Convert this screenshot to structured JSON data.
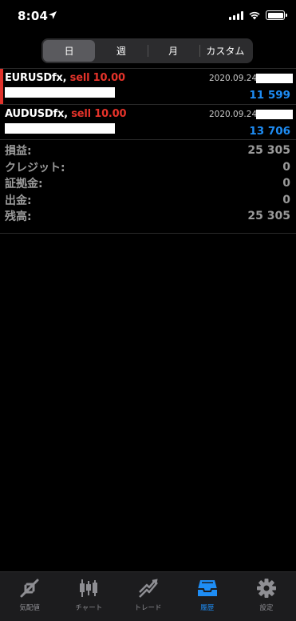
{
  "status_bar": {
    "time": "8:04"
  },
  "periods": [
    {
      "label": "日",
      "active": true
    },
    {
      "label": "週",
      "active": false
    },
    {
      "label": "月",
      "active": false
    },
    {
      "label": "カスタム",
      "active": false
    }
  ],
  "deals": [
    {
      "symbol": "EURUSDfx,",
      "action": "sell 10.00",
      "date": "2020.09.24",
      "profit": "11 599"
    },
    {
      "symbol": "AUDUSDfx,",
      "action": "sell 10.00",
      "date": "2020.09.24",
      "profit": "13 706"
    }
  ],
  "summary": [
    {
      "label": "損益:",
      "value": "25 305"
    },
    {
      "label": "クレジット:",
      "value": "0"
    },
    {
      "label": "証拠金:",
      "value": "0"
    },
    {
      "label": "出金:",
      "value": "0"
    },
    {
      "label": "残高:",
      "value": "25 305"
    }
  ],
  "tabs": [
    {
      "label": "気配値",
      "icon": "quotes-icon"
    },
    {
      "label": "チャート",
      "icon": "chart-icon"
    },
    {
      "label": "トレード",
      "icon": "trade-icon"
    },
    {
      "label": "履歴",
      "icon": "history-icon",
      "active": true
    },
    {
      "label": "設定",
      "icon": "gear-icon"
    }
  ],
  "colors": {
    "sell": "#e5332a",
    "profit": "#1e8df5",
    "active_tab": "#1e8df5"
  }
}
